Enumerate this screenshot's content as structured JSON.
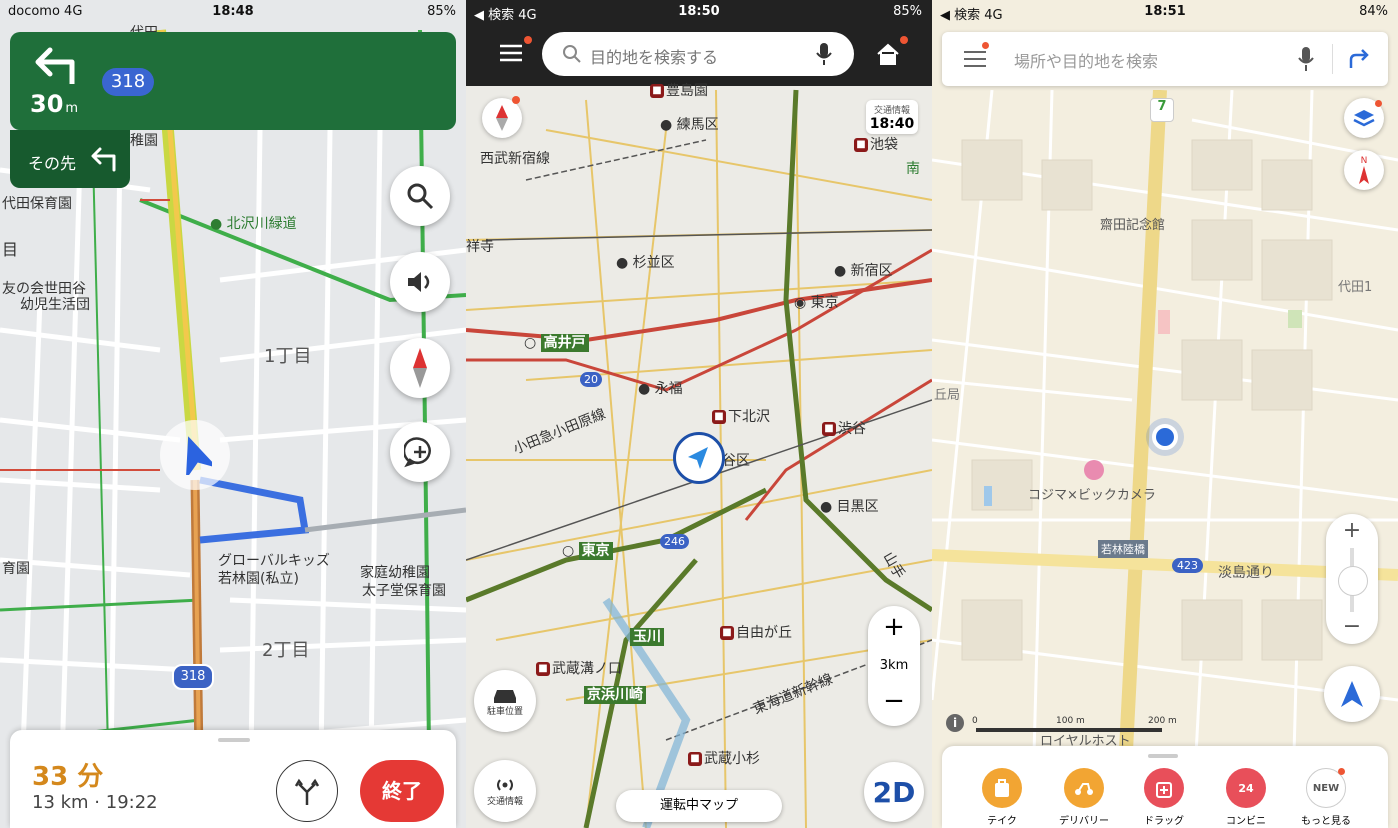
{
  "p1": {
    "status": {
      "carrier": "docomo 4G",
      "time": "18:48",
      "battery": "85%"
    },
    "turn_distance": "30",
    "turn_unit": "m",
    "route_badge": "318",
    "next_label": "その先",
    "map_labels": [
      "代田",
      "稚園",
      "代田保育園",
      "目",
      "北沢川緑道",
      "友の会世田谷",
      "幼児生活団",
      "1丁目",
      "グローバルキッズ",
      "若林園(私立)",
      "家庭幼稚園",
      "太子堂保育園",
      "2丁目",
      "育園"
    ],
    "road_badge": "318",
    "eta_time": "33 分",
    "eta_detail": "13 km · 19:22",
    "end_label": "終了"
  },
  "p2": {
    "status": {
      "carrier": "◀ 検索 4G",
      "time": "18:50",
      "battery": "85%"
    },
    "search_placeholder": "目的地を検索する",
    "traffic_caption": "交通情報",
    "traffic_time": "18:40",
    "map_labels": [
      "豊島園",
      "練馬区",
      "西武新宿線",
      "池袋",
      "南",
      "祥寺",
      "杉並区",
      "新宿区",
      "東京",
      "高井戸",
      "20",
      "永福",
      "下北沢",
      "渋谷",
      "小田急小田原線",
      "谷区",
      "目黒区",
      "東京",
      "246",
      "山手",
      "玉川",
      "自由が丘",
      "武蔵溝ノ口",
      "京浜川崎",
      "東海道新幹線",
      "武蔵小杉"
    ],
    "parking_label": "駐車位置",
    "traffic_info_label": "交通情報",
    "driving_map_label": "運転中マップ",
    "scale": "3km",
    "view_mode": "2D"
  },
  "p3": {
    "status": {
      "carrier": "◀ 検索 4G",
      "time": "18:51",
      "battery": "84%"
    },
    "search_placeholder": "場所や目的地を検索",
    "map_labels": [
      "齋田記念館",
      "代田1",
      "丘局",
      "コジマ×ビックカメラ",
      "若林陸橋",
      "423",
      "淡島通り",
      "ロイヤルホスト"
    ],
    "scale_0": "0",
    "scale_100": "100 m",
    "scale_200": "200 m",
    "compass_n": "N",
    "tabs": [
      {
        "label": "テイク",
        "color": "#f2a533"
      },
      {
        "label": "デリバリー",
        "color": "#f2a533"
      },
      {
        "label": "ドラッグ",
        "color": "#e84f5a"
      },
      {
        "label": "コンビニ",
        "color": "#e84f5a"
      },
      {
        "label": "もっと見る",
        "color": "#ffffff"
      }
    ],
    "new_badge": "NEW",
    "conv_num": "24"
  }
}
